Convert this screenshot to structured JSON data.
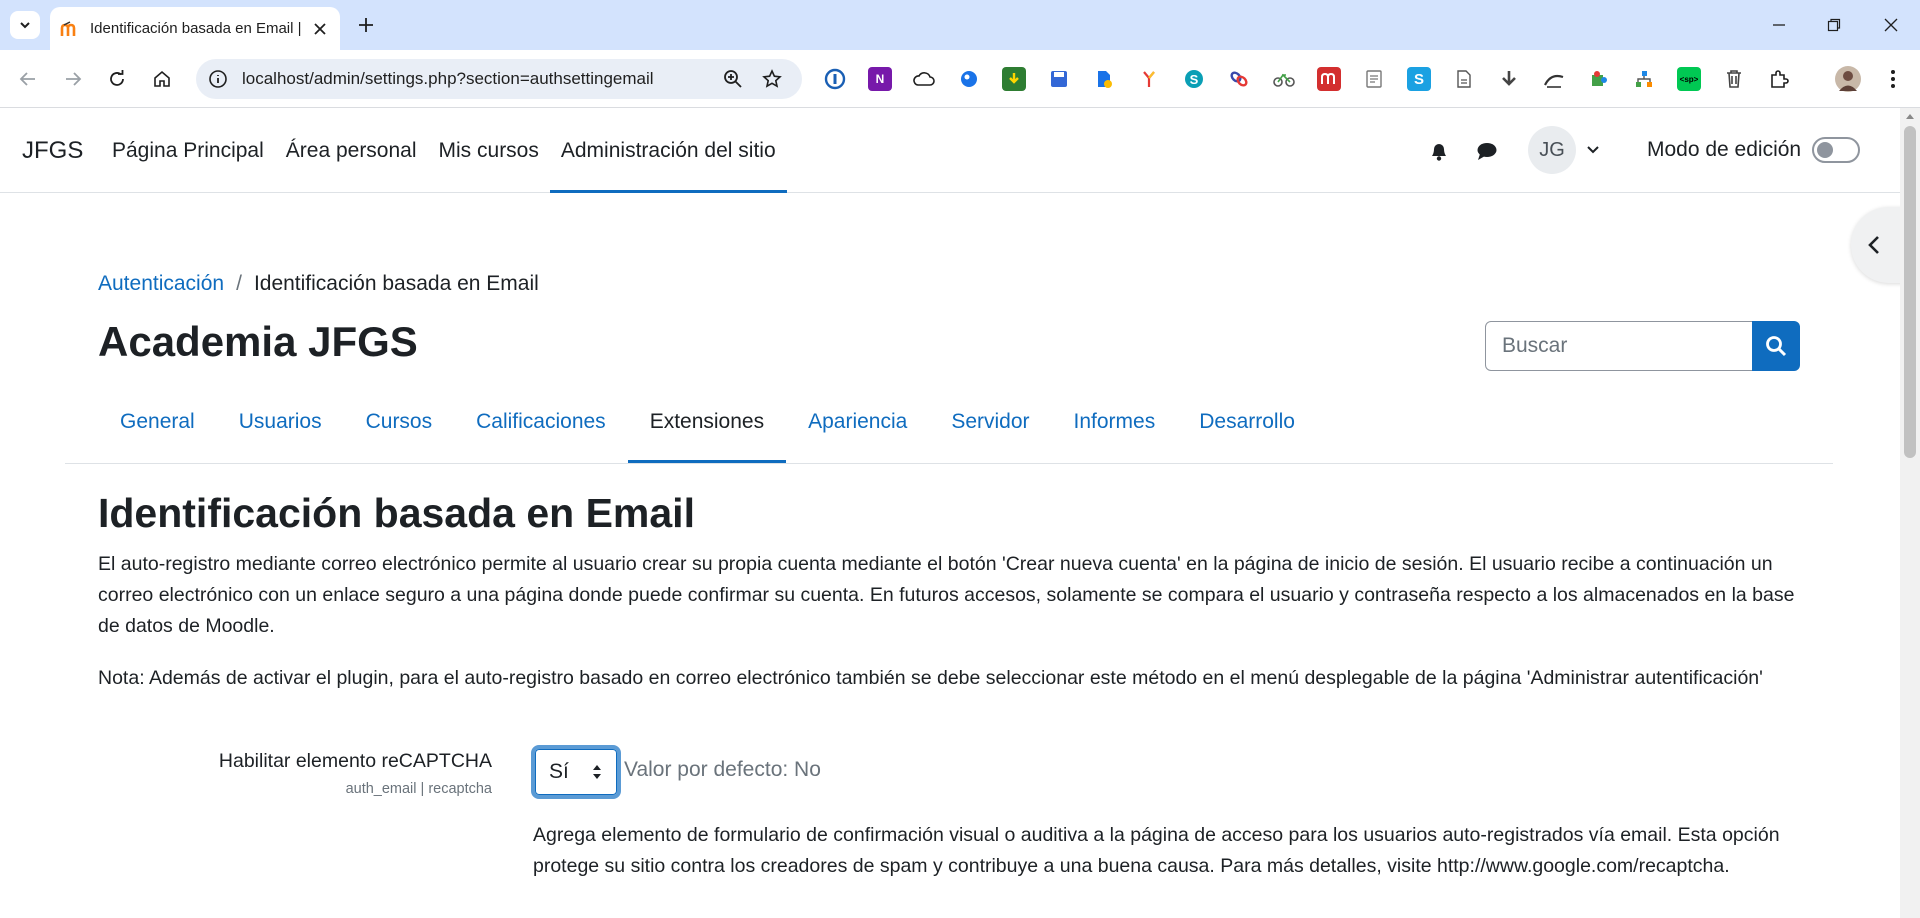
{
  "browser": {
    "tab_title": "Identificación basada en Email |",
    "url": "localhost/admin/settings.php?section=authsettingemail"
  },
  "navbar": {
    "brand": "JFGS",
    "items": [
      {
        "label": "Página Principal"
      },
      {
        "label": "Área personal"
      },
      {
        "label": "Mis cursos"
      },
      {
        "label": "Administración del sitio"
      }
    ],
    "avatar_initials": "JG",
    "edit_mode_label": "Modo de edición",
    "edit_mode_on": false
  },
  "breadcrumb": {
    "link": "Autenticación",
    "separator": "/",
    "current": "Identificación basada en Email"
  },
  "site_title": "Academia JFGS",
  "search": {
    "placeholder": "Buscar"
  },
  "secondary_nav": [
    {
      "label": "General"
    },
    {
      "label": "Usuarios"
    },
    {
      "label": "Cursos"
    },
    {
      "label": "Calificaciones"
    },
    {
      "label": "Extensiones"
    },
    {
      "label": "Apariencia"
    },
    {
      "label": "Servidor"
    },
    {
      "label": "Informes"
    },
    {
      "label": "Desarrollo"
    }
  ],
  "secondary_nav_active": "Extensiones",
  "page_heading": "Identificación basada en Email",
  "description": "El auto-registro mediante correo electrónico permite al usuario crear su propia cuenta mediante el botón 'Crear nueva cuenta' en la página de inicio de sesión. El usuario recibe a continuación un correo electrónico con un enlace seguro a una página donde puede confirmar su cuenta. En futuros accesos, solamente se compara el usuario y contraseña respecto a los almacenados en la base de datos de Moodle.",
  "note": "Nota: Además de activar el plugin, para el auto-registro basado en correo electrónico también se debe seleccionar este método en el menú desplegable de la página 'Administrar autentificación'",
  "setting": {
    "title": "Habilitar elemento reCAPTCHA",
    "key": "auth_email | recaptcha",
    "selected_value": "Sí",
    "default_text": "Valor por defecto: No",
    "description": "Agrega elemento de formulario de confirmación visual o auditiva a la página de acceso para los usuarios auto-registrados vía email. Esta opción protege su sitio contra los creadores de spam y contribuye a una buena causa. Para más detalles, visite http://www.google.com/recaptcha."
  },
  "extensions": {
    "icons": [
      "1password-icon",
      "onenote-icon",
      "cloud-icon",
      "circle-blue-icon",
      "download-green-icon",
      "save-icon",
      "doc-extension-icon",
      "branch-icon",
      "s-circle-icon",
      "link-icon",
      "bike-icon",
      "mendeley-icon",
      "notes-icon",
      "s-square-icon",
      "pdf-icon",
      "download-arrow-icon",
      "reader-icon",
      "puzzle-green-icon",
      "tree-icon",
      "sp-icon",
      "trash-icon",
      "extensions-puzzle-icon"
    ]
  },
  "colors": {
    "accent": "#0f6cbf",
    "tabbar": "#d3e3fd",
    "text": "#1d2125",
    "muted": "#6a737b"
  }
}
